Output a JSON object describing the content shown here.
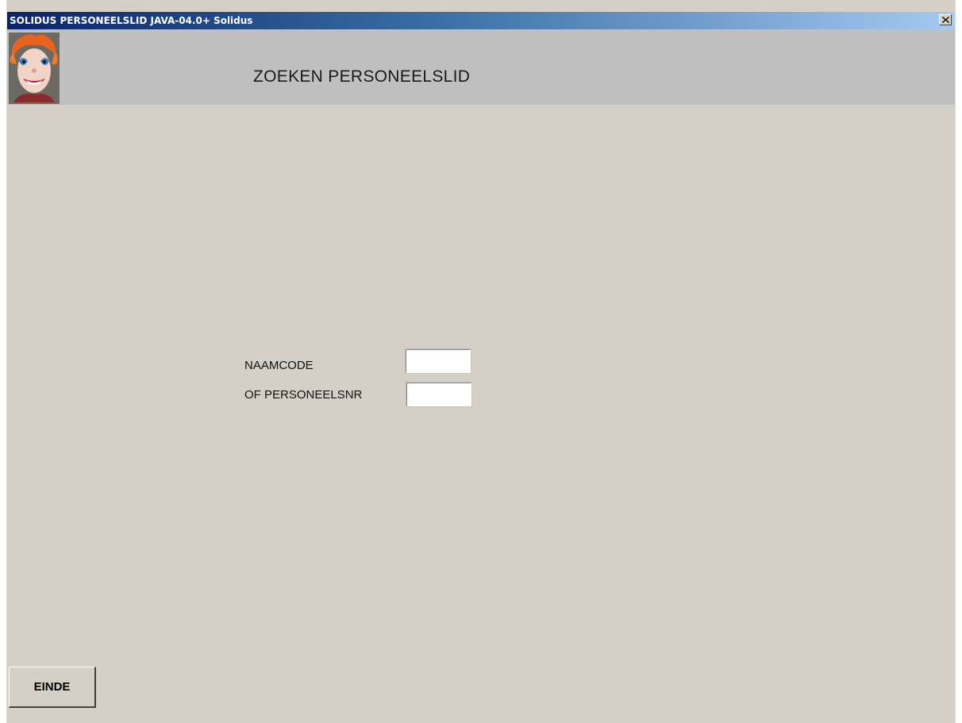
{
  "window": {
    "title": "SOLIDUS PERSONEELSLID JAVA-04.0+ Solidus",
    "close_icon": "close-x-icon"
  },
  "header": {
    "logo_icon": "clown-face-logo",
    "title": "ZOEKEN PERSONEELSLID"
  },
  "form": {
    "naamcode": {
      "label": "NAAMCODE",
      "value": ""
    },
    "personeelsnr": {
      "label": "OF PERSONEELSNR",
      "value": ""
    }
  },
  "footer": {
    "einde_label": "EINDE"
  },
  "colors": {
    "window_bg": "#d4d0c8",
    "header_band": "#c0c0c0",
    "titlebar_start": "#0a246a",
    "titlebar_end": "#a6caf0"
  }
}
